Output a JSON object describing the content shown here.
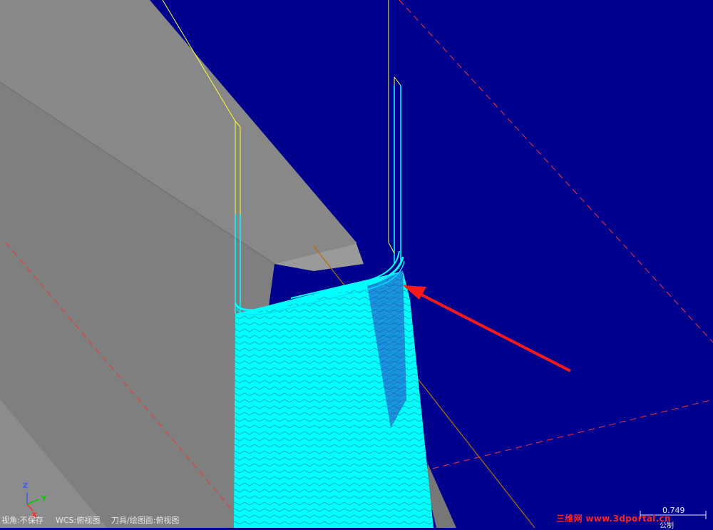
{
  "status_bar": {
    "view": "视角:不保存",
    "wcs": "WCS:俯视图",
    "tool_plane": "刀具/绘图面:俯视图"
  },
  "axis_triad": {
    "z": "Z",
    "y": "Y",
    "x": "X"
  },
  "watermark": "三维网 www.3dportal.cn",
  "scale_indicator": {
    "value": "0.749",
    "unit": "公制"
  },
  "colors": {
    "background": "#00008e",
    "part_surface": "#838383",
    "part_face_light": "#9a9a9a",
    "toolpath": "#00ffff",
    "retract_lines": "#ffff33",
    "construction_dashes": "#ff3030",
    "annotation_arrow": "#ff1818"
  }
}
